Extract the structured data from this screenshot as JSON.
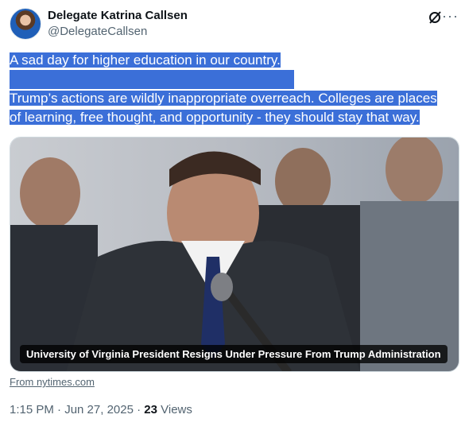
{
  "author": {
    "name": "Delegate Katrina Callsen",
    "handle": "@DelegateCallsen"
  },
  "icons": {
    "grok": "grok-icon",
    "more": "more-icon"
  },
  "tweet": {
    "line1": "A sad day for higher education in our country.",
    "line2": "Trump’s actions are wildly inappropriate overreach. Colleges are places",
    "line3": "of learning, free thought, and opportunity - they should stay that way."
  },
  "card": {
    "caption": "University of Virginia President Resigns Under Pressure From Trump Administration",
    "source": "From nytimes.com"
  },
  "meta": {
    "timestamp": "1:15 PM · Jun 27, 2025",
    "separator": " · ",
    "views_count": "23",
    "views_label": " Views"
  },
  "colors": {
    "selection": "#3b6fd8",
    "secondary_text": "#536471"
  }
}
